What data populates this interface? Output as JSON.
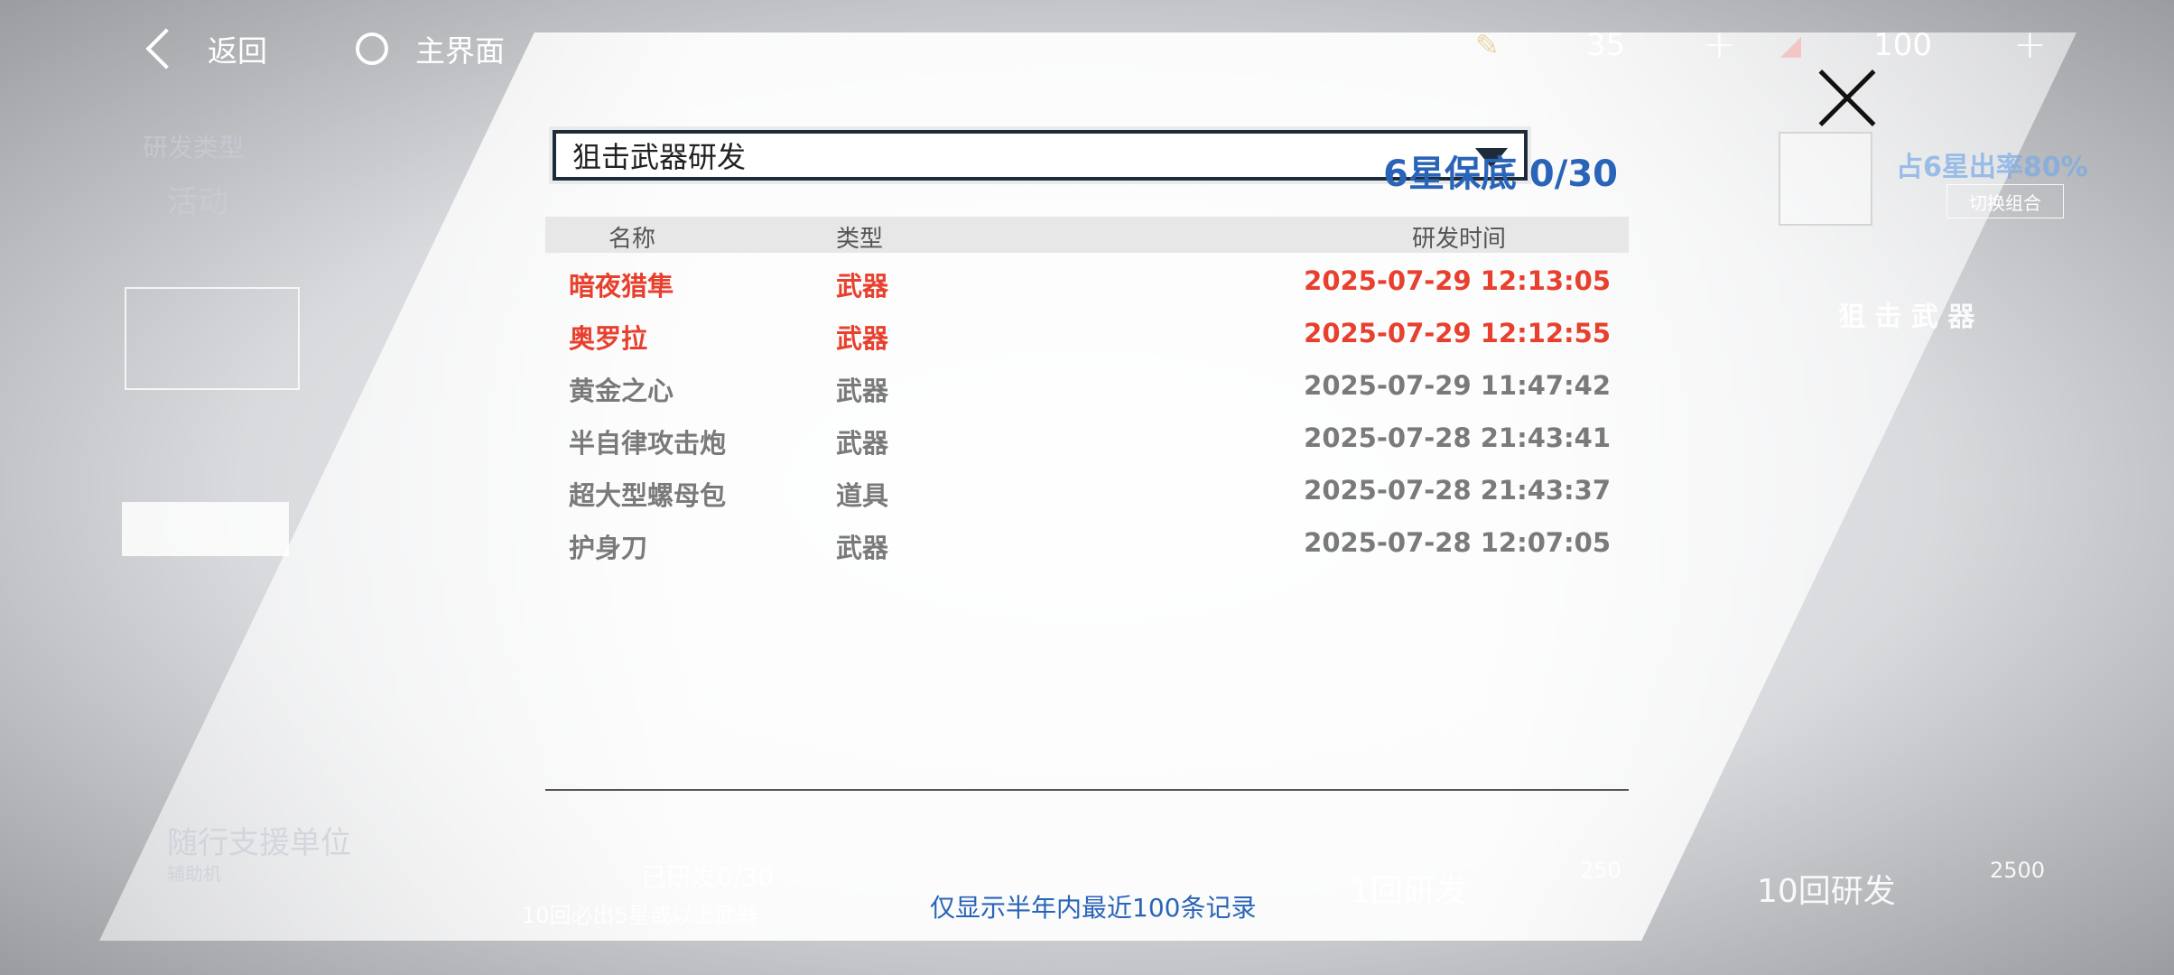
{
  "topbar": {
    "back_label": "返回",
    "home_label": "主界面",
    "resource1_value": "35",
    "resource2_value": "100",
    "plus": "+"
  },
  "background": {
    "category_label": "研发类型",
    "activity_label": "活动",
    "companion_label": "随行支援单位",
    "companion_sub": "辅助机",
    "rate_text": "占6星出率80%",
    "switch_label": "切换组合",
    "weapon_word": "狙 击 武 器",
    "progress_text": "已研发0/30",
    "guarantee_text": "10回必出5星或以上武器",
    "single_label": "1回研发",
    "single_cost": "250",
    "ten_label": "10回研发",
    "ten_cost": "2500"
  },
  "dialog": {
    "dropdown_value": "狙击武器研发",
    "pity_text": "6星保底 0/30",
    "columns": {
      "name": "名称",
      "type": "类型",
      "time": "研发时间"
    },
    "rows": [
      {
        "name": "暗夜猎隼",
        "type": "武器",
        "time": "2025-07-29 12:13:05",
        "highlight": true
      },
      {
        "name": "奥罗拉",
        "type": "武器",
        "time": "2025-07-29 12:12:55",
        "highlight": true
      },
      {
        "name": "黄金之心",
        "type": "武器",
        "time": "2025-07-29 11:47:42",
        "highlight": false
      },
      {
        "name": "半自律攻击炮",
        "type": "武器",
        "time": "2025-07-28 21:43:41",
        "highlight": false
      },
      {
        "name": "超大型螺母包",
        "type": "道具",
        "time": "2025-07-28 21:43:37",
        "highlight": false
      },
      {
        "name": "护身刀",
        "type": "武器",
        "time": "2025-07-28 12:07:05",
        "highlight": false
      }
    ],
    "footnote": "仅显示半年内最近100条记录"
  },
  "colors": {
    "highlight": "#e8402e",
    "accent": "#2a64b8",
    "normal": "#7a7a7a"
  }
}
